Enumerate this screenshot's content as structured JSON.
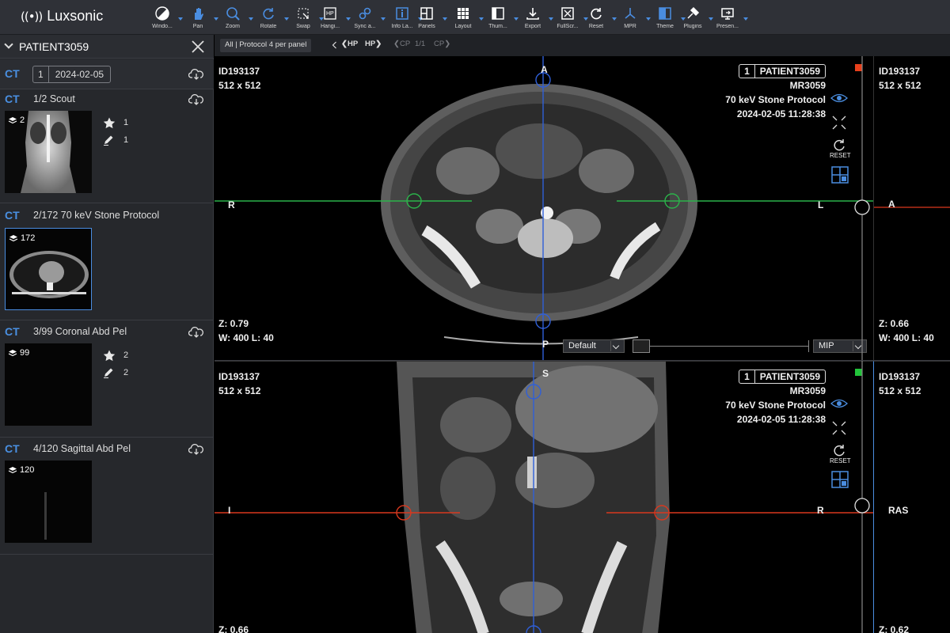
{
  "app": {
    "logo_mark": "((•))",
    "name": "Luxsonic"
  },
  "colors": {
    "accent": "#4a90e2",
    "red_marker": "#e8401c",
    "green_marker": "#21c43a",
    "axial_line": "#2bb34a",
    "coronal_line": "#d9381e",
    "vertical_line": "#2f5fd8"
  },
  "toolbar": [
    {
      "label": "Windo...",
      "icon": "window-level-icon"
    },
    {
      "label": "Pan",
      "icon": "pan-hand-icon"
    },
    {
      "label": "Zoom",
      "icon": "zoom-icon"
    },
    {
      "label": "Rotate",
      "icon": "rotate-icon"
    },
    {
      "label": "Swap",
      "icon": "swap-icon"
    },
    {
      "label": "Hangi...",
      "icon": "hanging-protocol-icon"
    },
    {
      "label": "Sync a...",
      "icon": "sync-icon"
    },
    {
      "label": "Info La...",
      "icon": "info-layer-icon"
    },
    {
      "label": "Panels",
      "icon": "panels-icon"
    },
    {
      "label": "Layout",
      "icon": "layout-grid-icon"
    },
    {
      "label": "Thum...",
      "icon": "thumbnails-icon"
    },
    {
      "label": "Export",
      "icon": "export-icon"
    },
    {
      "label": "FullScr...",
      "icon": "fullscreen-icon"
    },
    {
      "label": "Reset",
      "icon": "reset-icon"
    },
    {
      "label": "MPR",
      "icon": "mpr-icon"
    },
    {
      "label": "Theme",
      "icon": "theme-icon"
    },
    {
      "label": "Plugins",
      "icon": "plugins-icon"
    },
    {
      "label": "Presen...",
      "icon": "presentation-icon"
    }
  ],
  "sidebar": {
    "patient": "PATIENT3059",
    "study": {
      "modality": "CT",
      "number": "1",
      "date": "2024-02-05"
    },
    "series": [
      {
        "modality": "CT",
        "title": "1/2 Scout",
        "count": "2",
        "stars": "1",
        "annotations": "1"
      },
      {
        "modality": "CT",
        "title": "2/172 70 keV Stone Protocol",
        "count": "172"
      },
      {
        "modality": "CT",
        "title": "3/99 Coronal Abd Pel",
        "count": "99",
        "stars": "2",
        "annotations": "2"
      },
      {
        "modality": "CT",
        "title": "4/120 Sagittal Abd Pel",
        "count": "120"
      }
    ]
  },
  "tabbar": {
    "protocol": "All | Protocol 4 per panel",
    "hp_prev": "HP",
    "hp_next": "HP",
    "cp_label": "CP",
    "cp_page": "1/1",
    "cp_next": "CP"
  },
  "viewports": {
    "axial": {
      "id": "ID193137",
      "size": "512 x 512",
      "panel_no": "1",
      "patient": "PATIENT3059",
      "mr": "MR3059",
      "protocol": "70 keV Stone Protocol",
      "datetime": "2024-02-05 11:28:38",
      "reset": "RESET",
      "z": "Z: 0.79",
      "wl": "W: 400 L: 40",
      "top": "A",
      "bottom": "P",
      "left": "R",
      "right": "L",
      "preset": "Default",
      "mode": "MIP"
    },
    "coronal": {
      "id": "ID193137",
      "size": "512 x 512",
      "panel_no": "1",
      "patient": "PATIENT3059",
      "mr": "MR3059",
      "protocol": "70 keV Stone Protocol",
      "datetime": "2024-02-05 11:28:38",
      "reset": "RESET",
      "z": "Z: 0.66",
      "top": "S",
      "left": "I",
      "right": "R"
    },
    "sagittal": {
      "id": "ID193137",
      "size": "512 x 512",
      "z": "Z: 0.66",
      "wl": "W: 400 L: 40",
      "label": "A"
    },
    "volume": {
      "id": "ID193137",
      "size": "512 x 512",
      "z": "Z: 0.62",
      "label": "RAS"
    }
  }
}
